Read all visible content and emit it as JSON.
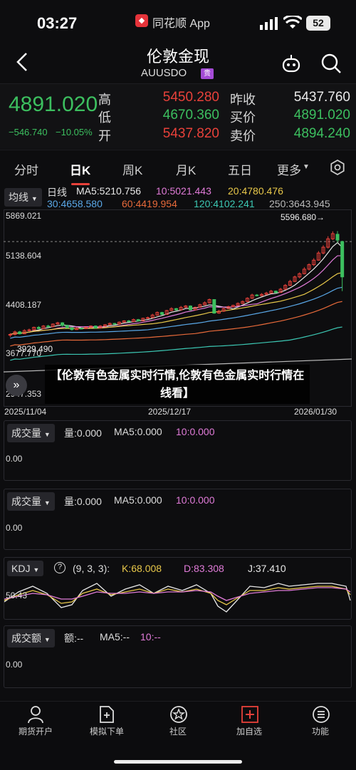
{
  "status": {
    "time": "03:27",
    "app_name": "同花顺 App",
    "battery": "52"
  },
  "header": {
    "title": "伦敦金现",
    "symbol": "AUUSDO",
    "badge": "贵"
  },
  "quote": {
    "price": "4891.020",
    "change": "−546.740",
    "change_pct": "−10.05%",
    "labels": {
      "high": "高",
      "low": "低",
      "open": "开",
      "prev_close": "昨收",
      "bid": "买价",
      "ask": "卖价"
    },
    "high": "5450.280",
    "low": "4670.360",
    "open": "5437.820",
    "prev_close": "5437.760",
    "bid": "4891.020",
    "ask": "4894.240"
  },
  "tabs": [
    "分时",
    "日K",
    "周K",
    "月K",
    "五日",
    "更多"
  ],
  "tabs_active": "日K",
  "main_chart": {
    "indicator_dd": "均线",
    "ma_title": "日线",
    "ma5": "MA5:5210.756",
    "ma10": "10:5021.443",
    "ma20": "20:4780.476",
    "ma30": "30:4658.580",
    "ma60": "60:4419.954",
    "ma120": "120:4102.241",
    "ma250": "250:3643.945",
    "y_ticks": [
      "5869.021",
      "5138.604",
      "4408.187",
      "3677.770",
      "2947.353"
    ],
    "max_label": "5596.680→",
    "min_label": "3929.490",
    "x_labels": [
      "2025/11/04",
      "2025/12/17",
      "2026/01/30"
    ]
  },
  "chart_data": {
    "type": "candlestick",
    "y_range": [
      2947.353,
      5869.021
    ],
    "candles": [
      [
        3990,
        4000,
        4020,
        3960
      ],
      [
        4000,
        4040,
        4060,
        3985
      ],
      [
        4040,
        4010,
        4055,
        4000
      ],
      [
        4010,
        4060,
        4080,
        4005
      ],
      [
        4060,
        4070,
        4090,
        4050
      ],
      [
        4070,
        4110,
        4120,
        4060
      ],
      [
        4110,
        4090,
        4130,
        4080
      ],
      [
        4090,
        4130,
        4145,
        4085
      ],
      [
        4130,
        4120,
        4150,
        4105
      ],
      [
        4120,
        4160,
        4170,
        4110
      ],
      [
        4160,
        4180,
        4195,
        4150
      ],
      [
        4180,
        4140,
        4190,
        4120
      ],
      [
        4140,
        4105,
        4150,
        4090
      ],
      [
        4105,
        4075,
        4115,
        4060
      ],
      [
        4075,
        4095,
        4110,
        4070
      ],
      [
        4095,
        4090,
        4105,
        4080
      ],
      [
        4090,
        4110,
        4120,
        4085
      ],
      [
        4110,
        4130,
        4140,
        4100
      ],
      [
        4130,
        4100,
        4140,
        4090
      ],
      [
        4100,
        4130,
        4145,
        4095
      ],
      [
        4130,
        4150,
        4160,
        4120
      ],
      [
        4150,
        4170,
        4185,
        4140
      ],
      [
        4170,
        4160,
        4180,
        4150
      ],
      [
        4160,
        4190,
        4200,
        4150
      ],
      [
        4190,
        4210,
        4220,
        4180
      ],
      [
        4210,
        4200,
        4225,
        4190
      ],
      [
        4200,
        4230,
        4245,
        4195
      ],
      [
        4230,
        4210,
        4240,
        4200
      ],
      [
        4210,
        4250,
        4260,
        4205
      ],
      [
        4250,
        4260,
        4275,
        4240
      ],
      [
        4260,
        4300,
        4320,
        4255
      ],
      [
        4300,
        4340,
        4355,
        4290
      ],
      [
        4340,
        4310,
        4350,
        4300
      ],
      [
        4310,
        4370,
        4380,
        4305
      ],
      [
        4370,
        4400,
        4420,
        4360
      ],
      [
        4400,
        4380,
        4410,
        4370
      ],
      [
        4380,
        4420,
        4440,
        4375
      ],
      [
        4420,
        4440,
        4455,
        4410
      ],
      [
        4440,
        4380,
        4450,
        4370
      ],
      [
        4380,
        4420,
        4430,
        4375
      ],
      [
        4420,
        4460,
        4475,
        4415
      ],
      [
        4460,
        4490,
        4510,
        4450
      ],
      [
        4490,
        4540,
        4555,
        4480
      ],
      [
        4540,
        4330,
        4545,
        4320
      ],
      [
        4330,
        4360,
        4380,
        4320
      ],
      [
        4360,
        4400,
        4415,
        4350
      ],
      [
        4400,
        4430,
        4445,
        4395
      ],
      [
        4430,
        4450,
        4460,
        4420
      ],
      [
        4450,
        4480,
        4495,
        4440
      ],
      [
        4480,
        4510,
        4525,
        4470
      ],
      [
        4510,
        4560,
        4575,
        4500
      ],
      [
        4560,
        4610,
        4630,
        4550
      ],
      [
        4610,
        4600,
        4625,
        4590
      ],
      [
        4600,
        4620,
        4640,
        4590
      ],
      [
        4620,
        4640,
        4660,
        4610
      ],
      [
        4640,
        4670,
        4690,
        4630
      ],
      [
        4670,
        4650,
        4680,
        4640
      ],
      [
        4650,
        4700,
        4720,
        4645
      ],
      [
        4700,
        4760,
        4780,
        4690
      ],
      [
        4760,
        4820,
        4845,
        4750
      ],
      [
        4820,
        4890,
        4910,
        4810
      ],
      [
        4890,
        4940,
        4960,
        4870
      ],
      [
        4940,
        5010,
        5040,
        4930
      ],
      [
        5010,
        5080,
        5100,
        4990
      ],
      [
        5080,
        5150,
        5180,
        5060
      ],
      [
        5150,
        5260,
        5290,
        5140
      ],
      [
        5260,
        5350,
        5380,
        5240
      ],
      [
        5350,
        5480,
        5520,
        5330
      ],
      [
        5480,
        5560,
        5596.68,
        5460
      ],
      [
        5550,
        5460,
        5600,
        5420
      ],
      [
        5437.82,
        4891.02,
        5450.28,
        4670.36
      ]
    ]
  },
  "volume1": {
    "dd": "成交量",
    "vol": "量:0.000",
    "ma5": "MA5:0.000",
    "ma10": "10:0.000",
    "y0": "0.00"
  },
  "volume2": {
    "dd": "成交量",
    "vol": "量:0.000",
    "ma5": "MA5:0.000",
    "ma10": "10:0.000",
    "y0": "0.00"
  },
  "kdj": {
    "dd": "KDJ",
    "params": "(9, 3, 3):",
    "k": "K:68.008",
    "d": "D:83.308",
    "j": "J:37.410",
    "y_label": "50.43"
  },
  "amount": {
    "dd": "成交额",
    "amt": "额:--",
    "ma5": "MA5:--",
    "ma10": "10:--",
    "y0": "0.00"
  },
  "banner": {
    "text": "【伦敦有色金属实时行情,伦敦有色金属实时行情在线看】"
  },
  "nav": [
    {
      "label": "期货开户",
      "icon": "person-icon"
    },
    {
      "label": "模拟下单",
      "icon": "document-icon"
    },
    {
      "label": "社区",
      "icon": "star-icon"
    },
    {
      "label": "加自选",
      "icon": "plus-box-icon"
    },
    {
      "label": "功能",
      "icon": "menu-icon"
    }
  ],
  "colors": {
    "up": "#e8413a",
    "down": "#3cbf5f",
    "accent": "#e8413a"
  }
}
